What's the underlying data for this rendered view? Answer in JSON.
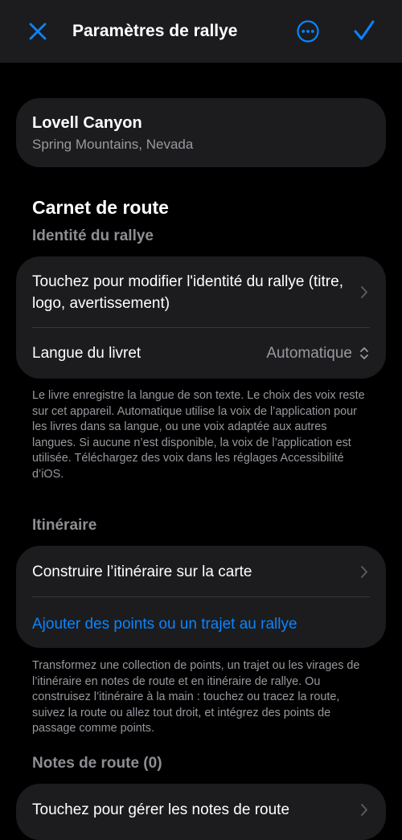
{
  "nav": {
    "title": "Paramètres de rallye",
    "close_icon": "xmark-icon",
    "more_icon": "ellipsis-circle-icon",
    "done_icon": "checkmark-icon",
    "accent_color": "#0a84ff"
  },
  "location": {
    "name": "Lovell Canyon",
    "region": "Spring Mountains, Nevada"
  },
  "roadbook": {
    "title": "Carnet de route",
    "identity_section": "Identité du rallye",
    "identity_row": "Touchez pour modifier l'identité du rallye (titre, logo, avertissement)",
    "language_label": "Langue du livret",
    "language_value": "Automatique",
    "language_footnote": "Le livre enregistre la langue de son texte. Le choix des voix reste sur cet appareil. Automatique utilise la voix de l’application pour les livres dans sa langue, ou une voix adaptée aux autres langues. Si aucune n’est disponible, la voix de l’application est utilisée. Téléchargez des voix dans les réglages Accessibilité d’iOS."
  },
  "itinerary": {
    "section": "Itinéraire",
    "build_row": "Construire l’itinéraire sur la carte",
    "add_link": "Ajouter des points ou un trajet au rallye",
    "footnote": "Transformez une collection de points, un trajet ou les virages de l’itinéraire en notes de route et en itinéraire de rallye. Ou construisez l’itinéraire à la main : touchez ou tracez la route, suivez la route ou allez tout droit, et intégrez des points de passage comme points."
  },
  "route_notes": {
    "section": "Notes de route (0)",
    "manage_row": "Touchez pour gérer les notes de route"
  }
}
